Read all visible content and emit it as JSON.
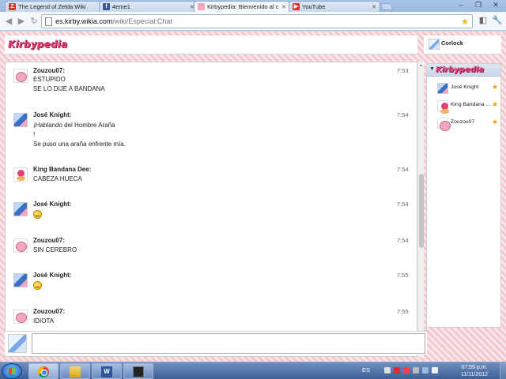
{
  "browser": {
    "tabs": [
      {
        "title": "The Legend of Zelda Wiki",
        "favicon": "Z",
        "favicon_color": "#d43a2c"
      },
      {
        "title": "4eme1",
        "favicon": "f",
        "favicon_color": "#3b5998"
      },
      {
        "title": "Kirbypedia: Bienvenido al c",
        "favicon": "",
        "favicon_color": "#f4a6bf"
      },
      {
        "title": "YouTube",
        "favicon": "▶",
        "favicon_color": "#e52d27"
      }
    ],
    "url_host": "es.kirby.wikia.com",
    "url_path": "/wiki/Especial:Chat"
  },
  "header": {
    "logo": "Kirbypedia",
    "current_user": "Corlock"
  },
  "chat": {
    "messages": [
      {
        "user": "Zouzou07:",
        "time": "7:53",
        "lines": [
          "ESTUPIDO",
          "SE LO DIJE A BANDANA"
        ]
      },
      {
        "user": "José Knight:",
        "time": "7:54",
        "lines": [
          "¡Hablando del Hombre Araña",
          "!",
          "Se puso una araña enfrente mía."
        ]
      },
      {
        "user": "King Bandana Dee:",
        "time": "7:54",
        "lines": [
          "CABEZA HUECA"
        ]
      },
      {
        "user": "José Knight:",
        "time": "7:54",
        "emoji": "neutral-face"
      },
      {
        "user": "Zouzou07:",
        "time": "7:54",
        "lines": [
          "SIN CEREBRO"
        ]
      },
      {
        "user": "José Knight:",
        "time": "7:55",
        "emoji": "frown-face"
      },
      {
        "user": "Zouzou07:",
        "time": "7:55",
        "lines": [
          "IDIOTA"
        ]
      }
    ],
    "input_value": ""
  },
  "sidebar": {
    "logo": "Kirbypedia",
    "members": [
      {
        "name": "José Knight",
        "avatar": "blue"
      },
      {
        "name": "King Bandana ...",
        "avatar": "bandana"
      },
      {
        "name": "Zouzou07",
        "avatar": "kirby"
      }
    ]
  },
  "taskbar": {
    "language": "ES",
    "time": "07:56 p.m.",
    "date": "11/11/2012",
    "word_label": "W"
  },
  "colors": {
    "accent": "#e23f7a",
    "page_pattern": "#f1c9cf",
    "star": "#f0a000"
  }
}
